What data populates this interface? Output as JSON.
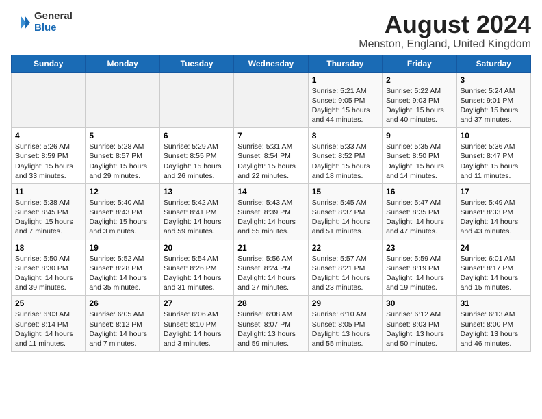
{
  "logo": {
    "general": "General",
    "blue": "Blue"
  },
  "header": {
    "title": "August 2024",
    "subtitle": "Menston, England, United Kingdom"
  },
  "weekdays": [
    "Sunday",
    "Monday",
    "Tuesday",
    "Wednesday",
    "Thursday",
    "Friday",
    "Saturday"
  ],
  "weeks": [
    [
      {
        "day": "",
        "sunrise": "",
        "sunset": "",
        "daylight": ""
      },
      {
        "day": "",
        "sunrise": "",
        "sunset": "",
        "daylight": ""
      },
      {
        "day": "",
        "sunrise": "",
        "sunset": "",
        "daylight": ""
      },
      {
        "day": "",
        "sunrise": "",
        "sunset": "",
        "daylight": ""
      },
      {
        "day": "1",
        "sunrise": "Sunrise: 5:21 AM",
        "sunset": "Sunset: 9:05 PM",
        "daylight": "Daylight: 15 hours and 44 minutes."
      },
      {
        "day": "2",
        "sunrise": "Sunrise: 5:22 AM",
        "sunset": "Sunset: 9:03 PM",
        "daylight": "Daylight: 15 hours and 40 minutes."
      },
      {
        "day": "3",
        "sunrise": "Sunrise: 5:24 AM",
        "sunset": "Sunset: 9:01 PM",
        "daylight": "Daylight: 15 hours and 37 minutes."
      }
    ],
    [
      {
        "day": "4",
        "sunrise": "Sunrise: 5:26 AM",
        "sunset": "Sunset: 8:59 PM",
        "daylight": "Daylight: 15 hours and 33 minutes."
      },
      {
        "day": "5",
        "sunrise": "Sunrise: 5:28 AM",
        "sunset": "Sunset: 8:57 PM",
        "daylight": "Daylight: 15 hours and 29 minutes."
      },
      {
        "day": "6",
        "sunrise": "Sunrise: 5:29 AM",
        "sunset": "Sunset: 8:55 PM",
        "daylight": "Daylight: 15 hours and 26 minutes."
      },
      {
        "day": "7",
        "sunrise": "Sunrise: 5:31 AM",
        "sunset": "Sunset: 8:54 PM",
        "daylight": "Daylight: 15 hours and 22 minutes."
      },
      {
        "day": "8",
        "sunrise": "Sunrise: 5:33 AM",
        "sunset": "Sunset: 8:52 PM",
        "daylight": "Daylight: 15 hours and 18 minutes."
      },
      {
        "day": "9",
        "sunrise": "Sunrise: 5:35 AM",
        "sunset": "Sunset: 8:50 PM",
        "daylight": "Daylight: 15 hours and 14 minutes."
      },
      {
        "day": "10",
        "sunrise": "Sunrise: 5:36 AM",
        "sunset": "Sunset: 8:47 PM",
        "daylight": "Daylight: 15 hours and 11 minutes."
      }
    ],
    [
      {
        "day": "11",
        "sunrise": "Sunrise: 5:38 AM",
        "sunset": "Sunset: 8:45 PM",
        "daylight": "Daylight: 15 hours and 7 minutes."
      },
      {
        "day": "12",
        "sunrise": "Sunrise: 5:40 AM",
        "sunset": "Sunset: 8:43 PM",
        "daylight": "Daylight: 15 hours and 3 minutes."
      },
      {
        "day": "13",
        "sunrise": "Sunrise: 5:42 AM",
        "sunset": "Sunset: 8:41 PM",
        "daylight": "Daylight: 14 hours and 59 minutes."
      },
      {
        "day": "14",
        "sunrise": "Sunrise: 5:43 AM",
        "sunset": "Sunset: 8:39 PM",
        "daylight": "Daylight: 14 hours and 55 minutes."
      },
      {
        "day": "15",
        "sunrise": "Sunrise: 5:45 AM",
        "sunset": "Sunset: 8:37 PM",
        "daylight": "Daylight: 14 hours and 51 minutes."
      },
      {
        "day": "16",
        "sunrise": "Sunrise: 5:47 AM",
        "sunset": "Sunset: 8:35 PM",
        "daylight": "Daylight: 14 hours and 47 minutes."
      },
      {
        "day": "17",
        "sunrise": "Sunrise: 5:49 AM",
        "sunset": "Sunset: 8:33 PM",
        "daylight": "Daylight: 14 hours and 43 minutes."
      }
    ],
    [
      {
        "day": "18",
        "sunrise": "Sunrise: 5:50 AM",
        "sunset": "Sunset: 8:30 PM",
        "daylight": "Daylight: 14 hours and 39 minutes."
      },
      {
        "day": "19",
        "sunrise": "Sunrise: 5:52 AM",
        "sunset": "Sunset: 8:28 PM",
        "daylight": "Daylight: 14 hours and 35 minutes."
      },
      {
        "day": "20",
        "sunrise": "Sunrise: 5:54 AM",
        "sunset": "Sunset: 8:26 PM",
        "daylight": "Daylight: 14 hours and 31 minutes."
      },
      {
        "day": "21",
        "sunrise": "Sunrise: 5:56 AM",
        "sunset": "Sunset: 8:24 PM",
        "daylight": "Daylight: 14 hours and 27 minutes."
      },
      {
        "day": "22",
        "sunrise": "Sunrise: 5:57 AM",
        "sunset": "Sunset: 8:21 PM",
        "daylight": "Daylight: 14 hours and 23 minutes."
      },
      {
        "day": "23",
        "sunrise": "Sunrise: 5:59 AM",
        "sunset": "Sunset: 8:19 PM",
        "daylight": "Daylight: 14 hours and 19 minutes."
      },
      {
        "day": "24",
        "sunrise": "Sunrise: 6:01 AM",
        "sunset": "Sunset: 8:17 PM",
        "daylight": "Daylight: 14 hours and 15 minutes."
      }
    ],
    [
      {
        "day": "25",
        "sunrise": "Sunrise: 6:03 AM",
        "sunset": "Sunset: 8:14 PM",
        "daylight": "Daylight: 14 hours and 11 minutes."
      },
      {
        "day": "26",
        "sunrise": "Sunrise: 6:05 AM",
        "sunset": "Sunset: 8:12 PM",
        "daylight": "Daylight: 14 hours and 7 minutes."
      },
      {
        "day": "27",
        "sunrise": "Sunrise: 6:06 AM",
        "sunset": "Sunset: 8:10 PM",
        "daylight": "Daylight: 14 hours and 3 minutes."
      },
      {
        "day": "28",
        "sunrise": "Sunrise: 6:08 AM",
        "sunset": "Sunset: 8:07 PM",
        "daylight": "Daylight: 13 hours and 59 minutes."
      },
      {
        "day": "29",
        "sunrise": "Sunrise: 6:10 AM",
        "sunset": "Sunset: 8:05 PM",
        "daylight": "Daylight: 13 hours and 55 minutes."
      },
      {
        "day": "30",
        "sunrise": "Sunrise: 6:12 AM",
        "sunset": "Sunset: 8:03 PM",
        "daylight": "Daylight: 13 hours and 50 minutes."
      },
      {
        "day": "31",
        "sunrise": "Sunrise: 6:13 AM",
        "sunset": "Sunset: 8:00 PM",
        "daylight": "Daylight: 13 hours and 46 minutes."
      }
    ]
  ]
}
